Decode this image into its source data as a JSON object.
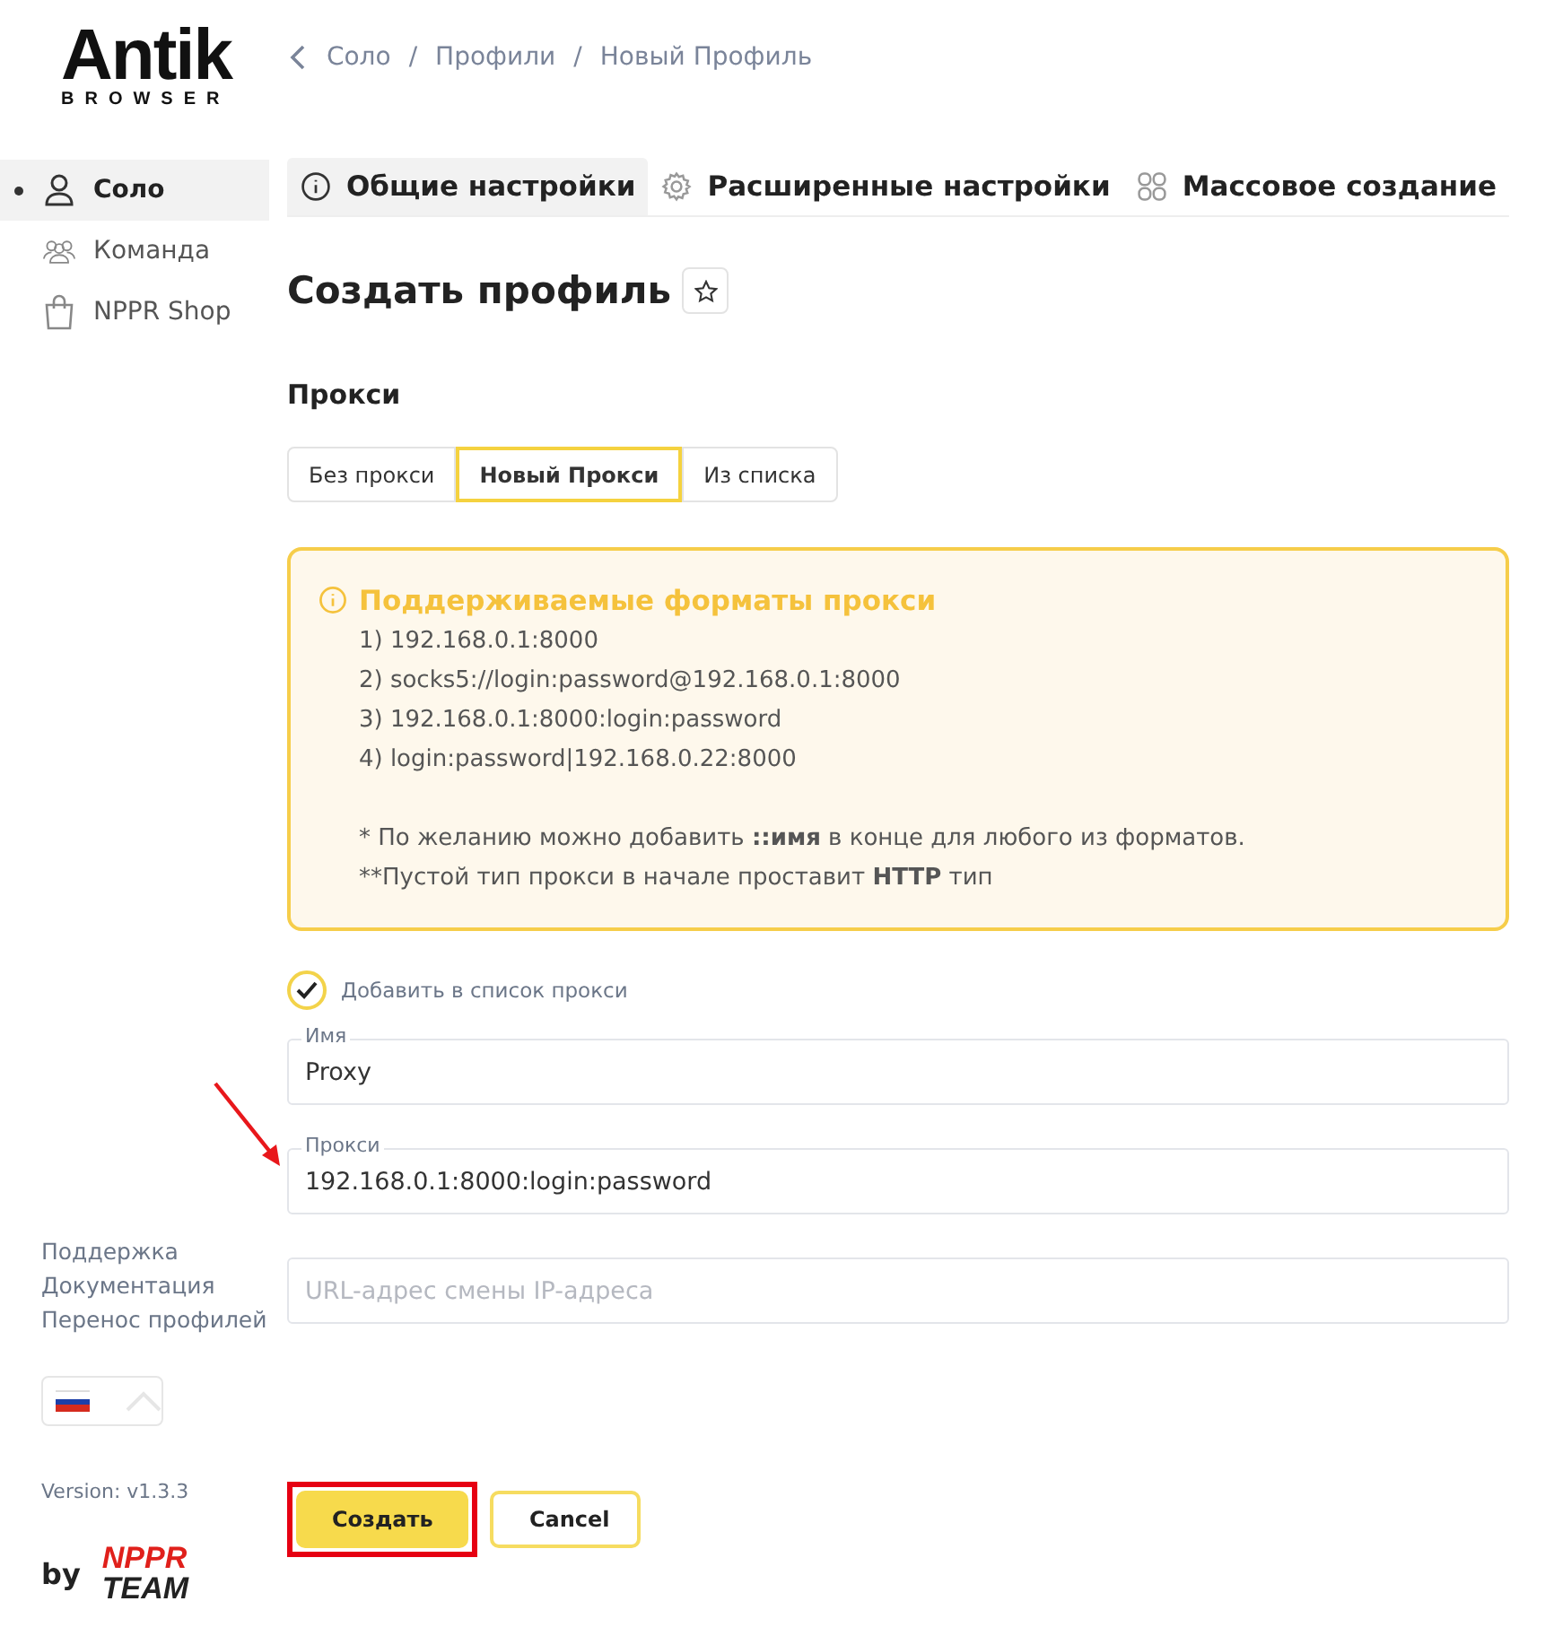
{
  "logo": {
    "title": "Antik",
    "subtitle": "BROWSER"
  },
  "breadcrumb": [
    "Соло",
    "/",
    "Профили",
    "/",
    "Новый Профиль"
  ],
  "nav": [
    {
      "label": "Соло",
      "selected": true
    },
    {
      "label": "Команда",
      "selected": false
    },
    {
      "label": "NPPR Shop",
      "selected": false
    }
  ],
  "sidebar_links": [
    "Поддержка",
    "Документация",
    "Перенос профилей"
  ],
  "version": "Version: v1.3.3",
  "credit": {
    "by": "by",
    "brand_top": "NPPR",
    "brand_bottom": "TEAM"
  },
  "tabs": [
    {
      "label": "Общие настройки",
      "selected": true
    },
    {
      "label": "Расширенные настройки",
      "selected": false
    },
    {
      "label": "Массовое создание",
      "selected": false
    }
  ],
  "page_title": "Создать профиль",
  "section_title": "Прокси",
  "proxy_modes": [
    {
      "label": "Без прокси",
      "selected": false
    },
    {
      "label": "Новый Прокси",
      "selected": true
    },
    {
      "label": "Из списка",
      "selected": false
    }
  ],
  "info_box": {
    "title": "Поддерживаемые форматы прокси",
    "lines": [
      "1) 192.168.0.1:8000",
      "2) socks5://login:password@192.168.0.1:8000",
      "3) 192.168.0.1:8000:login:password",
      "4) login:password|192.168.0.22:8000"
    ],
    "notes": [
      {
        "before": "* По желанию можно добавить ",
        "bold": "::имя",
        "after": " в конце для любого из форматов."
      },
      {
        "before": "**Пустой тип прокси в начале проставит ",
        "bold": "HTTP",
        "after": " тип"
      }
    ]
  },
  "add_to_list": {
    "label": "Добавить в список прокси",
    "checked": true
  },
  "fields": [
    {
      "label": "Имя",
      "value": "Proxy"
    },
    {
      "label": "Прокси",
      "value": "192.168.0.1:8000:login:password",
      "pointed": true
    },
    {
      "placeholder": "URL-адрес смены IP-адреса"
    }
  ],
  "buttons": [
    {
      "label": "Создать",
      "kind": "primary",
      "highlighted": true
    },
    {
      "label": "Cancel",
      "kind": "secondary"
    }
  ]
}
